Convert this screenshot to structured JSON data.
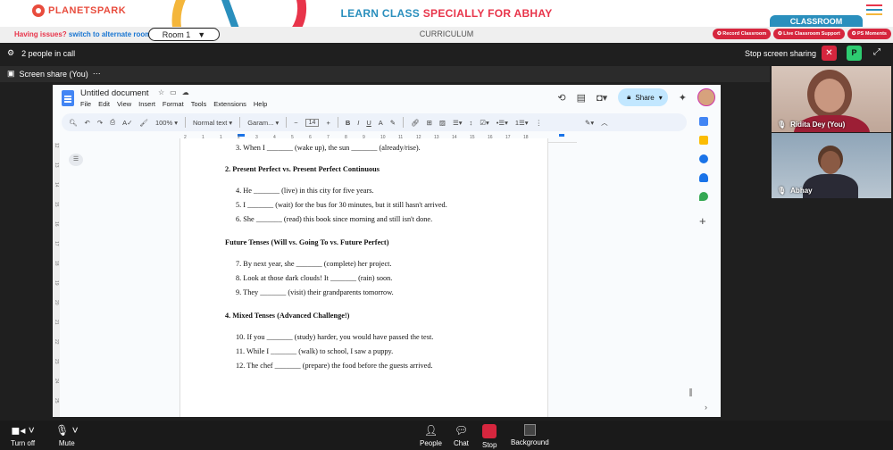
{
  "brand": {
    "name": "PLANETSPARK"
  },
  "banner": {
    "prefix": "LEARN CLASS ",
    "highlight": "SPECIALLY FOR ABHAY"
  },
  "classroom_tab": "CLASSROOM",
  "subbar": {
    "issues": "Having issues?",
    "switch_link": "switch to alternate room",
    "room_label": "Room 1",
    "curriculum": "CURRICULUM",
    "pills": [
      "Record Classroom",
      "Live Classroom Support",
      "PS Moments"
    ]
  },
  "callbar": {
    "people": "2 people in call",
    "stop_sharing": "Stop screen sharing",
    "presenter_initial": "P"
  },
  "sharebar": {
    "tab": "Screen share (You)"
  },
  "doc": {
    "title": "Untitled document",
    "menus": [
      "File",
      "Edit",
      "View",
      "Insert",
      "Format",
      "Tools",
      "Extensions",
      "Help"
    ],
    "share_label": "Share",
    "zoom": "100%",
    "style": "Normal text",
    "font": "Garam...",
    "font_size": "14",
    "ruler_ticks": [
      "2",
      "1",
      "1",
      "2",
      "3",
      "4",
      "5",
      "6",
      "7",
      "8",
      "9",
      "10",
      "11",
      "12",
      "13",
      "14",
      "15",
      "16",
      "17",
      "18"
    ],
    "vruler_ticks": [
      "12",
      "13",
      "14",
      "15",
      "16",
      "17",
      "18",
      "19",
      "20",
      "21",
      "22",
      "23",
      "24",
      "25",
      "26"
    ],
    "lines": [
      {
        "text": "3.  When I _______ (wake up), the sun _______ (already/rise).",
        "indent": 12,
        "bold": false
      },
      {
        "text": "2. Present Perfect vs. Present Perfect Continuous",
        "indent": 0,
        "bold": true
      },
      {
        "text": "4.  He _______ (live) in this city for five years.",
        "indent": 12,
        "bold": false
      },
      {
        "text": "5.  I _______ (wait) for the bus for 30 minutes, but it still hasn't arrived.",
        "indent": 12,
        "bold": false
      },
      {
        "text": "6.  She _______ (read) this book since morning and still isn't done.",
        "indent": 12,
        "bold": false
      },
      {
        "text": "Future Tenses (Will vs. Going To vs. Future Perfect)",
        "indent": 0,
        "bold": true
      },
      {
        "text": "7.  By next year, she _______ (complete) her project.",
        "indent": 12,
        "bold": false
      },
      {
        "text": "8.  Look at those dark clouds! It _______ (rain) soon.",
        "indent": 12,
        "bold": false
      },
      {
        "text": "9.  They _______ (visit) their grandparents tomorrow.",
        "indent": 12,
        "bold": false
      },
      {
        "text": "4. Mixed Tenses (Advanced Challenge!)",
        "indent": 0,
        "bold": true
      },
      {
        "text": "10. If you _______ (study) harder, you would have passed the test.",
        "indent": 12,
        "bold": false
      },
      {
        "text": "11. While I _______ (walk) to school, I saw a puppy.",
        "indent": 12,
        "bold": false
      },
      {
        "text": "12. The chef _______ (prepare) the food before the guests arrived.",
        "indent": 12,
        "bold": false
      }
    ]
  },
  "participants": [
    {
      "name": "Ridita Dey (You)"
    },
    {
      "name": "Abhay"
    }
  ],
  "bottom": {
    "turn_off": "Turn off",
    "mute": "Mute",
    "people": "People",
    "chat": "Chat",
    "stop": "Stop",
    "background": "Background"
  },
  "colors": {
    "accent_red": "#d6263e",
    "accent_blue": "#2a8fbd",
    "green": "#2ecc71"
  }
}
